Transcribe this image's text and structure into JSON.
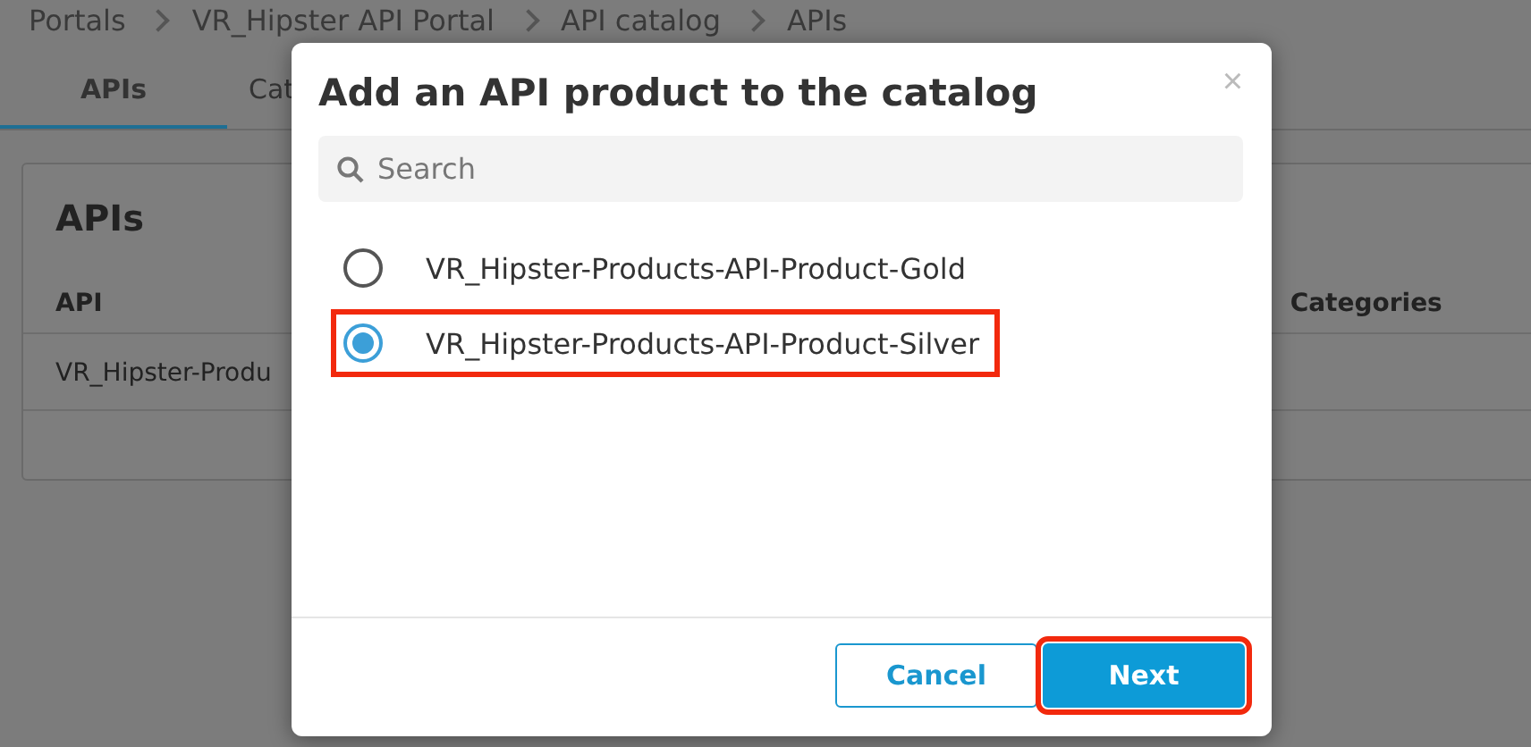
{
  "breadcrumb": [
    "Portals",
    "VR_Hipster API Portal",
    "API catalog",
    "APIs"
  ],
  "tabs": [
    {
      "label": "APIs",
      "selected": true
    },
    {
      "label": "Cat",
      "selected": false
    }
  ],
  "card": {
    "title": "APIs",
    "columns": [
      "API",
      "Categories"
    ],
    "rows": [
      [
        "VR_Hipster-Produ"
      ]
    ]
  },
  "dialog": {
    "title": "Add an API product to the catalog",
    "close": "×",
    "search": {
      "placeholder": "Search"
    },
    "options": [
      {
        "label": "VR_Hipster-Products-API-Product-Gold",
        "selected": false,
        "highlighted": false
      },
      {
        "label": "VR_Hipster-Products-API-Product-Silver",
        "selected": true,
        "highlighted": true
      }
    ],
    "buttons": [
      {
        "label": "Cancel",
        "kind": "secondary",
        "highlighted": false
      },
      {
        "label": "Next",
        "kind": "primary",
        "highlighted": true
      }
    ]
  }
}
